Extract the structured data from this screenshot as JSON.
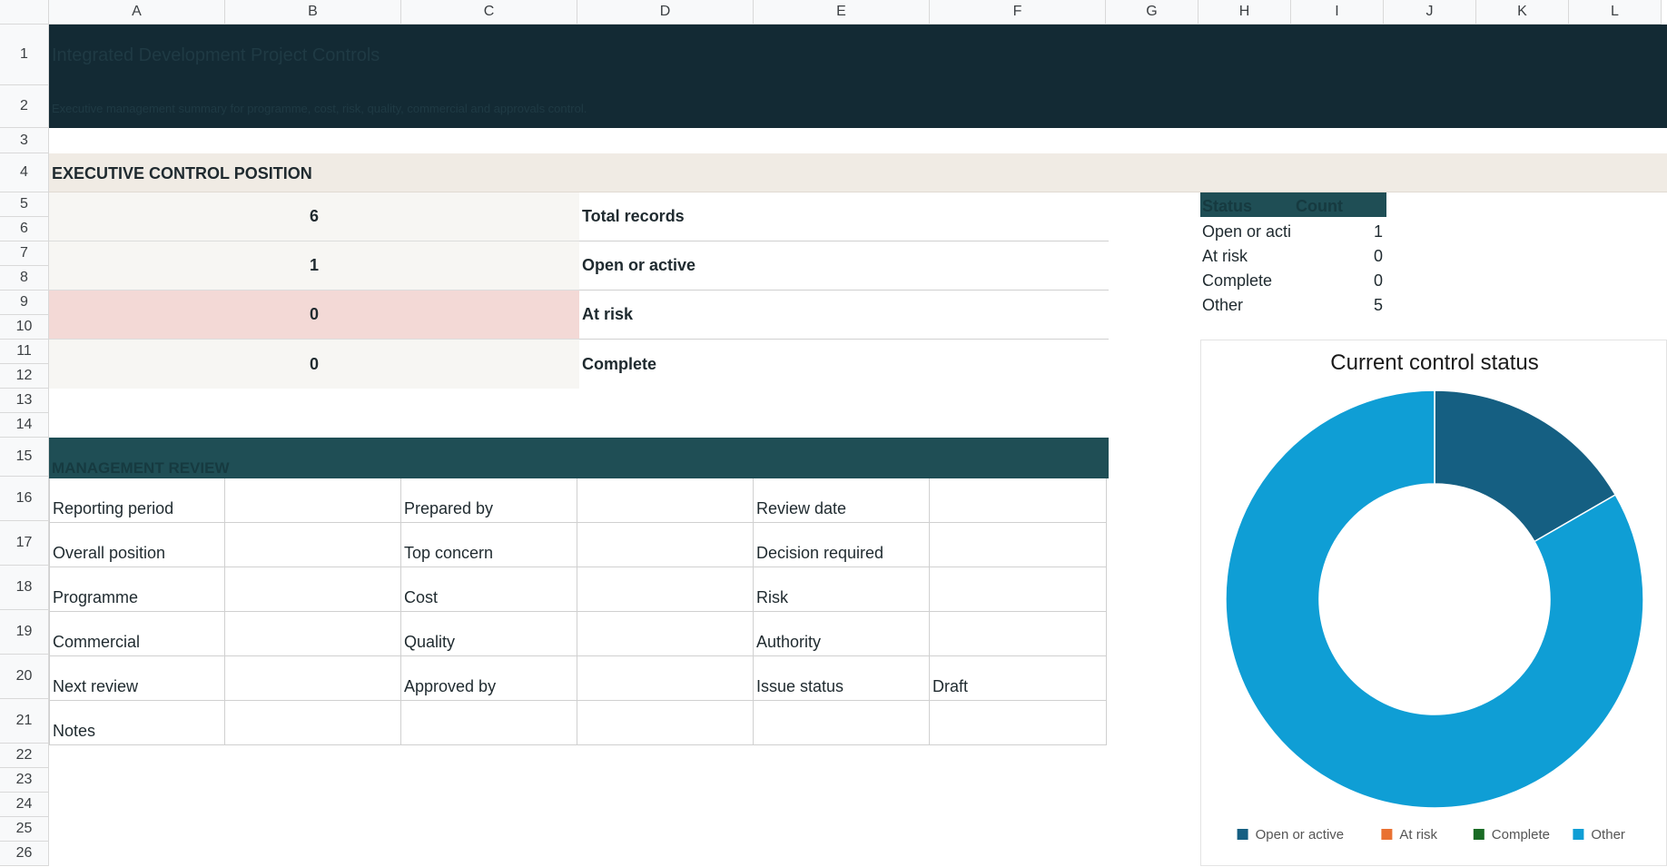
{
  "columns": [
    "A",
    "B",
    "C",
    "D",
    "E",
    "F",
    "G",
    "H",
    "I",
    "J",
    "K",
    "L"
  ],
  "rows": [
    "1",
    "2",
    "3",
    "4",
    "5",
    "6",
    "7",
    "8",
    "9",
    "10",
    "11",
    "12",
    "13",
    "14",
    "15",
    "16",
    "17",
    "18",
    "19",
    "20",
    "21",
    "22",
    "23",
    "24",
    "25",
    "26"
  ],
  "sheet": {
    "title": "Integrated Development Project Controls",
    "subtitle": "Executive management summary for programme, cost, risk, quality, commercial and approvals control."
  },
  "executive": {
    "heading": "EXECUTIVE CONTROL POSITION",
    "kpis": [
      {
        "value": "6",
        "label": "Total records"
      },
      {
        "value": "1",
        "label": "Open or active"
      },
      {
        "value": "0",
        "label": "At risk"
      },
      {
        "value": "0",
        "label": "Complete"
      }
    ]
  },
  "status_table": {
    "headers": [
      "Status",
      "Count"
    ],
    "rows": [
      {
        "status": "Open or acti",
        "count": "1"
      },
      {
        "status": "At risk",
        "count": "0"
      },
      {
        "status": "Complete",
        "count": "0"
      },
      {
        "status": "Other",
        "count": "5"
      }
    ]
  },
  "review": {
    "heading": "MANAGEMENT REVIEW",
    "rows": [
      [
        "Reporting period",
        "",
        "Prepared by",
        "",
        "Review date",
        ""
      ],
      [
        "Overall position",
        "",
        "Top concern",
        "",
        "Decision required",
        ""
      ],
      [
        "Programme",
        "",
        "Cost",
        "",
        "Risk",
        ""
      ],
      [
        "Commercial",
        "",
        "Quality",
        "",
        "Authority",
        ""
      ],
      [
        "Next review",
        "",
        "Approved by",
        "",
        "Issue status",
        "Draft"
      ],
      [
        "Notes",
        "",
        "",
        "",
        "",
        ""
      ]
    ]
  },
  "colors": {
    "banner": "#132a34",
    "section_band": "#f0ebe4",
    "teal_header": "#1f4e55",
    "kpi_fill": "#f7f6f3",
    "risk_fill": "#f3d9d6"
  },
  "chart_data": {
    "type": "pie",
    "donut": true,
    "title": "Current control status",
    "categories": [
      "Open or active",
      "At risk",
      "Complete",
      "Other"
    ],
    "values": [
      1,
      0,
      0,
      5
    ],
    "colors": [
      "#155f82",
      "#e97132",
      "#196b24",
      "#0f9ed5"
    ],
    "legend_position": "bottom"
  }
}
